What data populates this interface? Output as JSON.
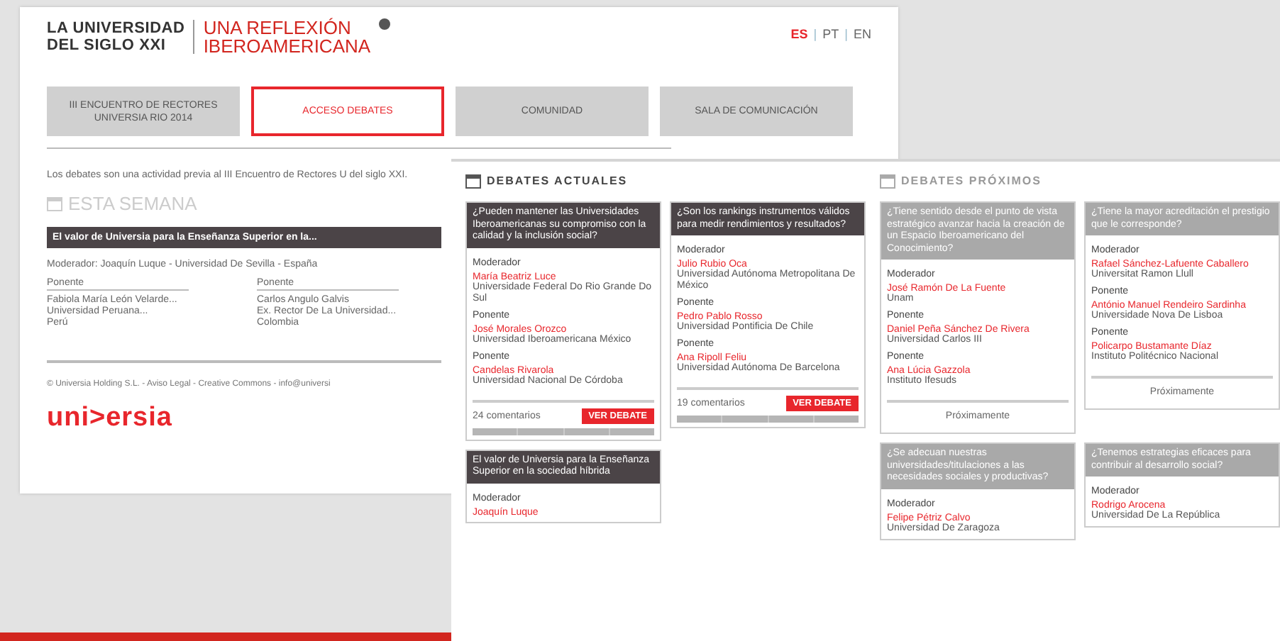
{
  "site_window": {
    "logo_left": [
      "LA UNIVERSIDAD",
      "DEL SIGLO XXI"
    ],
    "logo_right": [
      "UNA REFLEXIÓN",
      "IBEROAMERICANA"
    ],
    "language_separator": "|",
    "languages": [
      {
        "label": "ES",
        "selected": true
      },
      {
        "label": "PT",
        "selected": false
      },
      {
        "label": "EN",
        "selected": false
      }
    ],
    "nav": [
      {
        "label": "III ENCUENTRO DE RECTORES UNIVERSIA RIO 2014",
        "selected": false
      },
      {
        "label": "ACCESO DEBATES",
        "selected": true
      },
      {
        "label": "COMUNIDAD",
        "selected": false
      },
      {
        "label": "SALA DE COMUNICACIÓN",
        "selected": false
      }
    ],
    "intro": "Los debates son una actividad previa al III Encuentro de Rectores U del siglo XXI.",
    "this_week": {
      "heading": "ESTA SEMANA",
      "featured_title": "El valor de Universia para la Enseñanza Superior en la...",
      "moderator_line": "Moderador: Joaquín Luque - Universidad De Sevilla - España",
      "panelists": [
        {
          "heading": "Ponente",
          "lines": [
            "Fabiola María León Velarde...",
            "Universidad Peruana...",
            "Perú"
          ]
        },
        {
          "heading": "Ponente",
          "lines": [
            "Carlos Angulo Galvis",
            "Ex. Rector De La Universidad...",
            "Colombia"
          ]
        }
      ]
    },
    "footer": "© Universia Holding S.L. - Aviso Legal - Creative Commons - info@universi",
    "brand": "uni>ersia"
  },
  "debates_window": {
    "sections": [
      {
        "heading": "DEBATES ACTUALES",
        "kind": "current",
        "cards": [
          {
            "question": "¿Pueden mantener las Universidades Iberoamericanas su compromiso con la calidad y la inclusión social?",
            "roles": [
              {
                "role": "Moderador",
                "name": "María Beatriz Luce",
                "affiliation": "Universidade Federal Do Rio Grande Do Sul"
              },
              {
                "role": "Ponente",
                "name": "José Morales Orozco",
                "affiliation": "Universidad Iberoamericana México"
              },
              {
                "role": "Ponente",
                "name": "Candelas Rivarola",
                "affiliation": "Universidad Nacional De Córdoba"
              }
            ],
            "comments": "24 comentarios",
            "button": "VER DEBATE"
          },
          {
            "question": "¿Son los rankings instrumentos válidos para medir rendimientos y resultados?",
            "roles": [
              {
                "role": "Moderador",
                "name": "Julio Rubio Oca",
                "affiliation": "Universidad Autónoma Metropolitana De México"
              },
              {
                "role": "Ponente",
                "name": "Pedro Pablo Rosso",
                "affiliation": "Universidad Pontificia De Chile"
              },
              {
                "role": "Ponente",
                "name": "Ana Ripoll Feliu",
                "affiliation": "Universidad Autónoma De Barcelona"
              }
            ],
            "comments": "19 comentarios",
            "button": "VER DEBATE"
          },
          {
            "question": "El valor de Universia para la Enseñanza Superior en la sociedad híbrida",
            "roles": [
              {
                "role": "Moderador",
                "name": "Joaquín Luque"
              }
            ]
          }
        ]
      },
      {
        "heading": "DEBATES PRÓXIMOS",
        "kind": "upcoming",
        "cards": [
          {
            "question": "¿Tiene sentido desde el punto de vista estratégico avanzar hacia la creación de un Espacio Iberoamericano del Conocimiento?",
            "roles": [
              {
                "role": "Moderador",
                "name": "José Ramón De La Fuente",
                "affiliation": "Unam"
              },
              {
                "role": "Ponente",
                "name": "Daniel Peña Sánchez De Rivera",
                "affiliation": "Universidad Carlos III"
              },
              {
                "role": "Ponente",
                "name": "Ana Lúcia Gazzola",
                "affiliation": "Instituto Ifesuds"
              }
            ],
            "status": "Próximamente"
          },
          {
            "question": "¿Tiene la mayor acreditación el prestigio que le corresponde?",
            "roles": [
              {
                "role": "Moderador",
                "name": "Rafael Sánchez-Lafuente Caballero",
                "affiliation": "Universitat Ramon Llull"
              },
              {
                "role": "Ponente",
                "name": "António Manuel Rendeiro Sardinha",
                "affiliation": "Universidade Nova De Lisboa"
              },
              {
                "role": "Ponente",
                "name": "Policarpo Bustamante Díaz",
                "affiliation": "Instituto Politécnico Nacional"
              }
            ],
            "status": "Próximamente"
          },
          {
            "question": "¿Se adecuan nuestras universidades/titulaciones a las necesidades sociales y productivas?",
            "roles": [
              {
                "role": "Moderador",
                "name": "Felipe Pétriz Calvo",
                "affiliation": "Universidad De Zaragoza"
              }
            ]
          },
          {
            "question": "¿Tenemos estrategias eficaces para contribuir al desarrollo social?",
            "roles": [
              {
                "role": "Moderador",
                "name": "Rodrigo Arocena",
                "affiliation": "Universidad De La República"
              }
            ]
          }
        ]
      }
    ]
  }
}
